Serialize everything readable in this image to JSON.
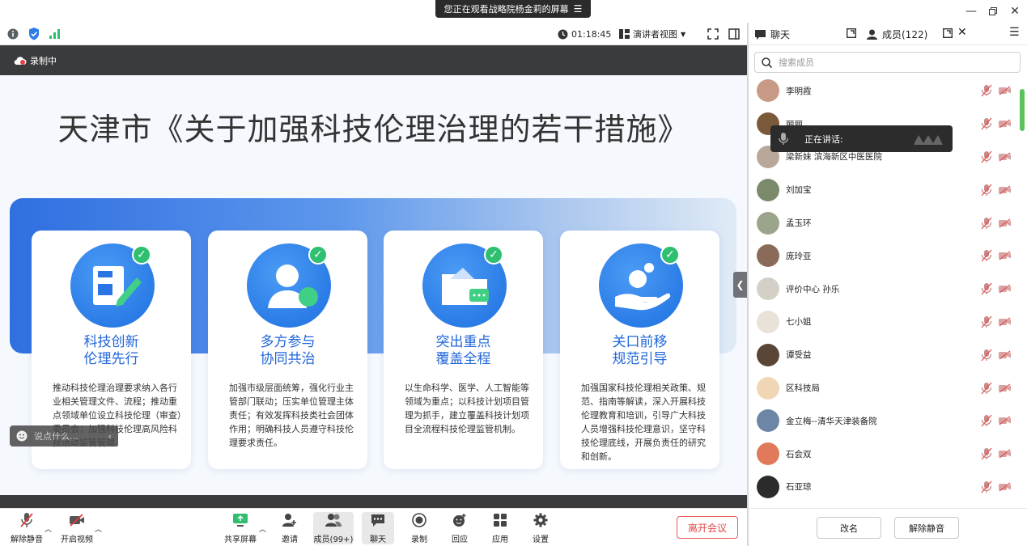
{
  "banner": {
    "text": "您正在观看战略院杨金莉的屏幕",
    "menu_icon": "list-icon"
  },
  "window_controls": {
    "minimize": "minimize-icon",
    "restore": "restore-icon",
    "close": "close-icon"
  },
  "toolbar_top": {
    "timer": "01:18:45",
    "view_mode": "演讲者视图"
  },
  "recording": {
    "label": "录制中"
  },
  "slide": {
    "title": "天津市《关于加强科技伦理治理的若干措施》",
    "cards": [
      {
        "head1": "科技创新",
        "head2": "伦理先行",
        "icon": "document-pen-icon",
        "body": "推动科技伦理治理要求纳入各行业相关管理文件、流程；推动重点领域单位设立科技伦理（审查）委员会；加强科技伦理高风险科技活动监管管理。"
      },
      {
        "head1": "多方参与",
        "head2": "协同共治",
        "icon": "person-icon",
        "body": "加强市级层面统筹，强化行业主管部门联动；压实单位管理主体责任；有效发挥科技类社会团体作用；明确科技人员遵守科技伦理要求责任。"
      },
      {
        "head1": "突出重点",
        "head2": "覆盖全程",
        "icon": "folder-icon",
        "body": "以生命科学、医学、人工智能等领域为重点；以科技计划项目管理为抓手，建立覆盖科技计划项目全流程科技伦理监管机制。"
      },
      {
        "head1": "关口前移",
        "head2": "规范引导",
        "icon": "hand-icon",
        "body": "加强国家科技伦理相关政策、规范、指南等解读，深入开展科技伦理教育和培训，引导广大科技人员增强科技伦理意识，坚守科技伦理底线，开展负责任的研究和创新。"
      }
    ]
  },
  "chat_input": {
    "placeholder": "说点什么..."
  },
  "bottom_toolbar": {
    "unmute": "解除静音",
    "start_video": "开启视频",
    "share": "共享屏幕",
    "invite": "邀请",
    "members": "成员(99+)",
    "chat": "聊天",
    "record": "录制",
    "react": "回应",
    "apps": "应用",
    "settings": "设置",
    "leave": "离开会议"
  },
  "panel": {
    "chat_tab": "聊天",
    "members_tab": "成员(122)",
    "search_placeholder": "搜索成员",
    "speaking_label": "正在讲话:",
    "members": [
      {
        "name": "李明霞",
        "color": "#c89a86"
      },
      {
        "name": "丽丽",
        "color": "#7a5a3a"
      },
      {
        "name": "梁新妹  滨海新区中医医院",
        "color": "#b9a899"
      },
      {
        "name": "刘加宝",
        "color": "#7b8a6a"
      },
      {
        "name": "孟玉环",
        "color": "#9aa58c"
      },
      {
        "name": "庞玲亚",
        "color": "#8a6b5a"
      },
      {
        "name": "评价中心  孙乐",
        "color": "#d5d0c7"
      },
      {
        "name": "七小姐",
        "color": "#e8e2d8"
      },
      {
        "name": "谭受益",
        "color": "#5a4636"
      },
      {
        "name": "区科技局",
        "color": "#f0d6b5"
      },
      {
        "name": "金立梅--清华天津装备院",
        "color": "#6d86a6"
      },
      {
        "name": "石会双",
        "color": "#e07a5a"
      },
      {
        "name": "石亚琼",
        "color": "#2b2b2b"
      }
    ],
    "rename": "改名",
    "unmute": "解除静音"
  }
}
